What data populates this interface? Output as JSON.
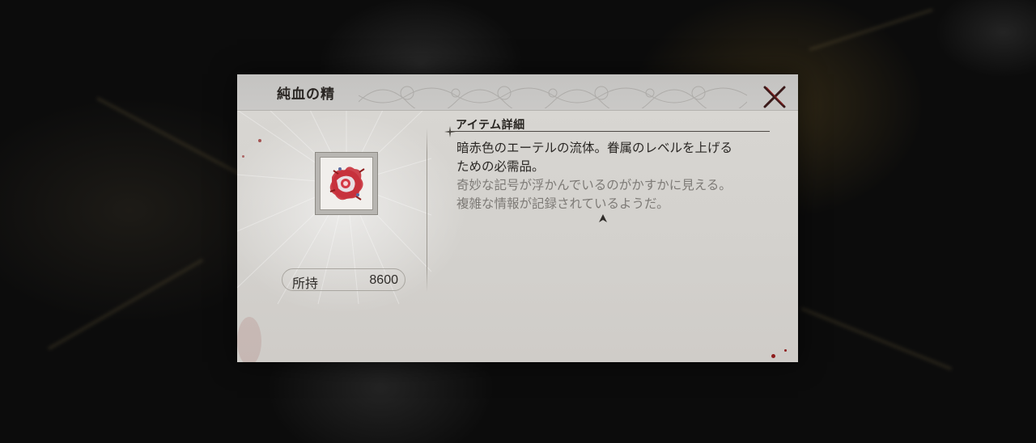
{
  "dialog": {
    "title": "純血の精",
    "close_icon": "close-x-icon"
  },
  "item": {
    "icon": "blood-essence-icon",
    "owned_label": "所持",
    "owned_count": "8600"
  },
  "details": {
    "section_title": "アイテム詳細",
    "lines": [
      "暗赤色のエーテルの流体。眷属のレベルを上げる",
      "ための必需品。",
      "奇妙な記号が浮かんでいるのがかすかに見える。",
      "複雑な情報が記録されているようだ。"
    ],
    "more_indicator_icon": "scroll-up-arrow-icon"
  },
  "colors": {
    "panel": "#d6d4d0",
    "header": "#c6c5c3",
    "text_dark": "#2a2724",
    "text_faded": "#7d7a76",
    "blood_accent": "#8e1d1d",
    "close_x": "#3a1a1a"
  }
}
